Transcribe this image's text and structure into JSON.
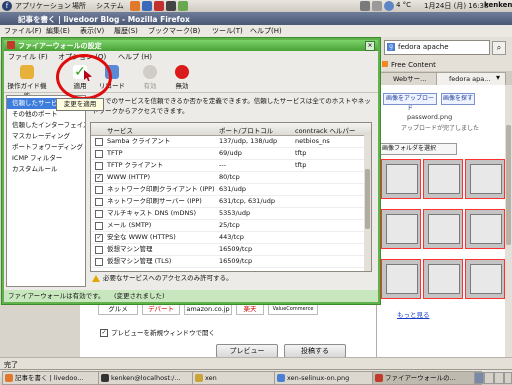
{
  "panel": {
    "menus": [
      "アプリケーション",
      "場所",
      "システム"
    ],
    "weather": "4 °C",
    "datetime": "1月24日 (月) 16:38",
    "user": "kenken"
  },
  "firefox": {
    "title": "記事を書く | livedoor Blog - Mozilla Firefox",
    "menu": [
      "ファイル(F)",
      "編集(E)",
      "表示(V)",
      "履歴(S)",
      "ブックマーク(B)",
      "ツール(T)",
      "ヘルプ(H)"
    ],
    "search_value": "fedora apache",
    "bookmark": "Free Content",
    "tabs": [
      "Webサー...",
      "fedora apa..."
    ],
    "status": "完了"
  },
  "web": {
    "upload_button": "画像をアップロード",
    "find_button": "画像を探す",
    "filename": "password.png",
    "upload_done": "アップロードが完了しました",
    "folder_select": "画像フォルダを選択",
    "more_link": "もっと見る",
    "shops": [
      "グルメ",
      "デパート",
      "amazon.co.jp",
      "楽天",
      "ValueCommerce"
    ],
    "preview_checkbox": "プレビューを新規ウィンドウで開く",
    "preview_button": "プレビュー",
    "submit_button": "投稿する"
  },
  "dialog": {
    "title": "ファイアーウォールの設定",
    "menu": [
      "ファイル (F)",
      "オプション (O)",
      "ヘルプ (H)"
    ],
    "toolbar": {
      "wizard": "操作ガイド機能",
      "apply": "適用",
      "reload": "リロード",
      "enable": "有効",
      "disable": "無効"
    },
    "tooltip": "変更を適用",
    "sidebar": [
      "信頼したサービス",
      "その他のポート",
      "信頼したインターフェイス",
      "マスカレーディング",
      "ポートフォワーディング",
      "ICMP フィルター",
      "カスタムルール"
    ],
    "description": "ここでのサービスを信頼できるか否かを定義できます。信頼したサービスは全てのホストやネットワークからアクセスできます。",
    "columns": [
      "サービス",
      "ポート/プロトコル",
      "conntrack ヘルパー"
    ],
    "services": [
      {
        "name": "Samba クライアント",
        "port": "137/udp, 138/udp",
        "helper": "netbios_ns",
        "checked": false
      },
      {
        "name": "TFTP",
        "port": "69/udp",
        "helper": "tftp",
        "checked": false
      },
      {
        "name": "TFTP クライアント",
        "port": "---",
        "helper": "tftp",
        "checked": false
      },
      {
        "name": "WWW (HTTP)",
        "port": "80/tcp",
        "helper": "",
        "checked": true
      },
      {
        "name": "ネットワーク印刷クライアント (IPP)",
        "port": "631/udp",
        "helper": "",
        "checked": false
      },
      {
        "name": "ネットワーク印刷サーバー (IPP)",
        "port": "631/tcp, 631/udp",
        "helper": "",
        "checked": false
      },
      {
        "name": "マルチキャスト DNS (mDNS)",
        "port": "5353/udp",
        "helper": "",
        "checked": false
      },
      {
        "name": "メール (SMTP)",
        "port": "25/tcp",
        "helper": "",
        "checked": false
      },
      {
        "name": "安全な WWW (HTTPS)",
        "port": "443/tcp",
        "helper": "",
        "checked": true
      },
      {
        "name": "仮想マシン管理",
        "port": "16509/tcp",
        "helper": "",
        "checked": false
      },
      {
        "name": "仮想マシン管理 (TLS)",
        "port": "16509/tcp",
        "helper": "",
        "checked": false
      }
    ],
    "warning": "必要なサービスへのアクセスのみ許可する。",
    "status_enabled": "ファイアーウォールは有効です。",
    "status_changed": "(変更されました)"
  },
  "taskbar": [
    "記事を書く | livedoo...",
    "kenken@localhost:/...",
    "xen",
    "xen-selinux-on.png",
    "ファイアーウォールの..."
  ]
}
